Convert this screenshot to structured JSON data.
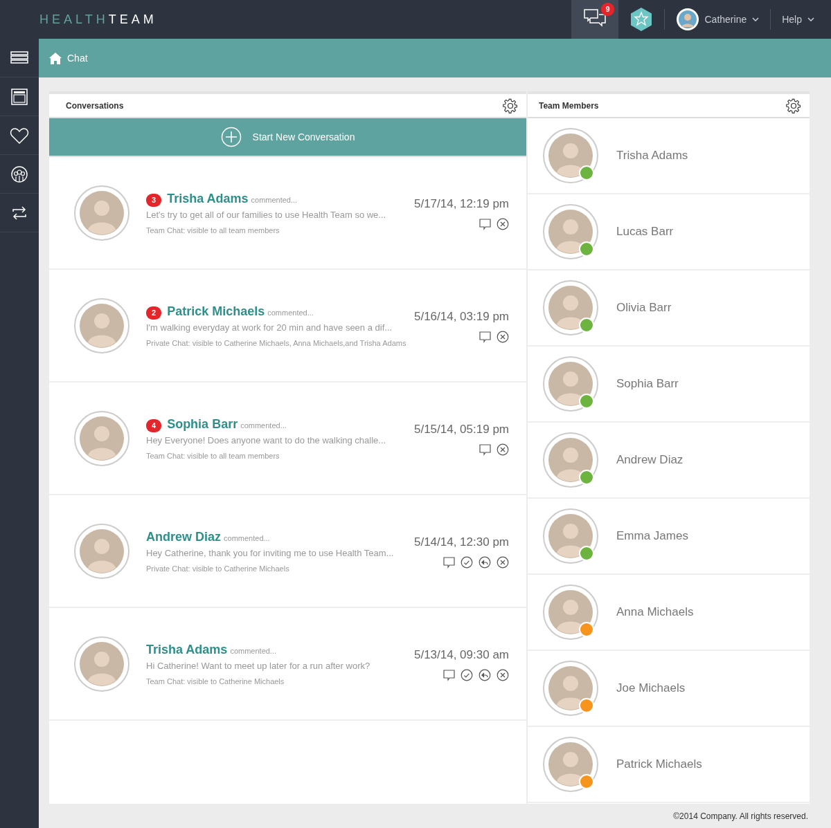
{
  "logo": [
    {
      "text": "HEALTH",
      "kind": "accent"
    },
    {
      "text": "TEAM",
      "kind": "plain"
    }
  ],
  "topbar": {
    "messages_count": "9",
    "user": "Catherine",
    "help": "Help"
  },
  "sidebar": {
    "items": [
      {
        "kind": "menu"
      },
      {
        "kind": "window"
      },
      {
        "kind": "heart"
      },
      {
        "kind": "group"
      },
      {
        "kind": "swap"
      }
    ]
  },
  "breadcrumb": {
    "label": "Chat"
  },
  "conversations": {
    "title": "Conversations",
    "start_button": "Start New Conversation",
    "items": [
      {
        "badge": "3",
        "name": "Trisha Adams",
        "action": "commented...",
        "preview": "Let's try to get all of our families to use Health Team so we...",
        "visibility": "Team Chat: visible to all team members",
        "time": "5/17/14, 12:19 pm",
        "actions": [
          {
            "kind": "comment"
          },
          {
            "kind": "close"
          }
        ]
      },
      {
        "badge": "2",
        "name": "Patrick Michaels",
        "action": "commented...",
        "preview": "I'm walking everyday at work for 20 min and have seen a dif...",
        "visibility": "Private Chat: visible to Catherine Michaels, Anna Michaels,and Trisha Adams",
        "time": "5/16/14, 03:19 pm",
        "actions": [
          {
            "kind": "comment"
          },
          {
            "kind": "close"
          }
        ]
      },
      {
        "badge": "4",
        "name": "Sophia Barr",
        "action": "commented...",
        "preview": "Hey Everyone! Does anyone want to do the walking challe...",
        "visibility": "Team Chat: visible to all team members",
        "time": "5/15/14, 05:19 pm",
        "actions": [
          {
            "kind": "comment"
          },
          {
            "kind": "close"
          }
        ]
      },
      {
        "name": "Andrew Diaz",
        "action": "commented...",
        "preview": "Hey Catherine, thank you for inviting me to use Health Team...",
        "visibility": "Private Chat: visible to Catherine Michaels",
        "time": "5/14/14, 12:30 pm",
        "actions": [
          {
            "kind": "comment"
          },
          {
            "kind": "check"
          },
          {
            "kind": "reply"
          },
          {
            "kind": "close"
          }
        ]
      },
      {
        "name": "Trisha Adams",
        "action": "commented...",
        "preview": "Hi Catherine! Want to meet up later for a run after work?",
        "visibility": "Team Chat: visible to Catherine Michaels",
        "time": "5/13/14, 09:30 am",
        "actions": [
          {
            "kind": "comment"
          },
          {
            "kind": "check"
          },
          {
            "kind": "reply"
          },
          {
            "kind": "close"
          }
        ]
      }
    ]
  },
  "team_members": {
    "title": "Team Members",
    "items": [
      {
        "name": "Trisha Adams",
        "color": "#6cb33f"
      },
      {
        "name": "Lucas Barr",
        "color": "#6cb33f"
      },
      {
        "name": "Olivia Barr",
        "color": "#6cb33f"
      },
      {
        "name": "Sophia Barr",
        "color": "#6cb33f"
      },
      {
        "name": "Andrew Diaz",
        "color": "#6cb33f"
      },
      {
        "name": "Emma James",
        "color": "#6cb33f"
      },
      {
        "name": "Anna Michaels",
        "color": "#f7941d"
      },
      {
        "name": "Joe Michaels",
        "color": "#f7941d"
      },
      {
        "name": "Patrick Michaels",
        "color": "#f7941d"
      }
    ]
  },
  "footer": "©2014 Company. All rights reserved."
}
